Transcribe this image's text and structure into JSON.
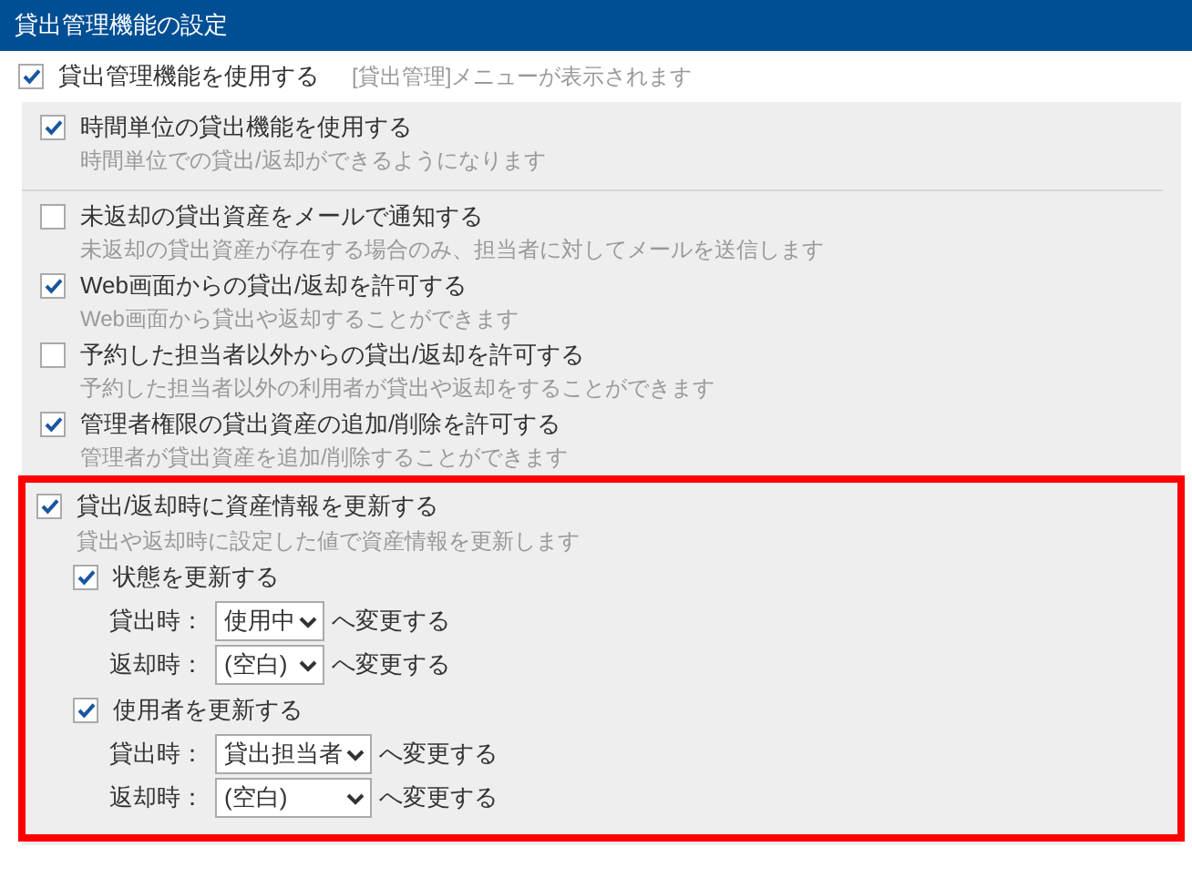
{
  "header": {
    "title": "貸出管理機能の設定"
  },
  "main_option": {
    "label": "貸出管理機能を使用する",
    "checked": true,
    "note": "[貸出管理]メニューが表示されます"
  },
  "option_groups": [
    [
      {
        "label": "時間単位の貸出機能を使用する",
        "description": "時間単位での貸出/返却ができるようになります",
        "checked": true
      }
    ],
    [
      {
        "label": "未返却の貸出資産をメールで通知する",
        "description": "未返却の貸出資産が存在する場合のみ、担当者に対してメールを送信します",
        "checked": false
      },
      {
        "label": "Web画面からの貸出/返却を許可する",
        "description": "Web画面から貸出や返却することができます",
        "checked": true
      },
      {
        "label": "予約した担当者以外からの貸出/返却を許可する",
        "description": "予約した担当者以外の利用者が貸出や返却をすることができます",
        "checked": false
      },
      {
        "label": "管理者権限の貸出資産の追加/削除を許可する",
        "description": "管理者が貸出資産を追加/削除することができます",
        "checked": true
      }
    ]
  ],
  "highlighted_option": {
    "label": "貸出/返却時に資産情報を更新する",
    "description": "貸出や返却時に設定した値で資産情報を更新します",
    "checked": true,
    "sub_options": [
      {
        "label": "状態を更新する",
        "checked": true,
        "rows": [
          {
            "label": "貸出時：",
            "value": "使用中",
            "suffix": "へ変更する"
          },
          {
            "label": "返却時：",
            "value": "(空白)",
            "suffix": "へ変更する"
          }
        ]
      },
      {
        "label": "使用者を更新する",
        "checked": true,
        "rows": [
          {
            "label": "貸出時：",
            "value": "貸出担当者",
            "suffix": "へ変更する"
          },
          {
            "label": "返却時：",
            "value": "(空白)",
            "suffix": "へ変更する"
          }
        ]
      }
    ]
  }
}
